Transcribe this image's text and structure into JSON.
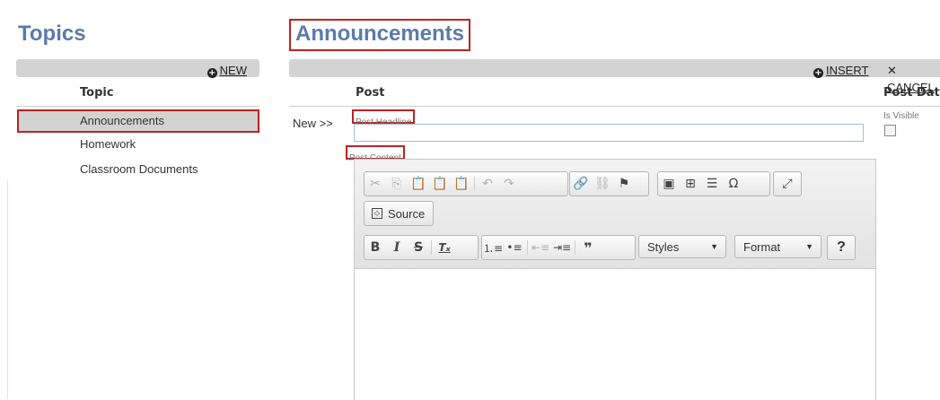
{
  "left": {
    "title": "Topics",
    "new_label": "NEW",
    "column_header": "Topic",
    "topics": [
      "Announcements",
      "Homework",
      "Classroom Documents"
    ]
  },
  "main": {
    "title": "Announcements",
    "insert_label": "INSERT",
    "cancel_label": "CANCEL",
    "col_post": "Post",
    "col_post_date": "Post Date",
    "new_row_label": "New >>",
    "headline_label": "Post Headline",
    "headline_value": "",
    "content_label": "Post Content",
    "is_visible_label": "Is Visible",
    "is_visible_checked": false
  },
  "editor": {
    "source_label": "Source",
    "styles_label": "Styles",
    "format_label": "Format",
    "help_label": "?",
    "icons": {
      "cut": "cut-icon",
      "copy": "copy-icon",
      "paste": "paste-icon",
      "paste_text": "paste-text-icon",
      "paste_word": "paste-word-icon",
      "undo": "undo-icon",
      "redo": "redo-icon",
      "link": "link-icon",
      "unlink": "unlink-icon",
      "anchor": "anchor-flag-icon",
      "image": "image-icon",
      "table": "table-icon",
      "hr": "horizontal-rule-icon",
      "special": "special-char-icon",
      "maximize": "maximize-icon"
    }
  },
  "colors": {
    "heading": "#5b7bab",
    "highlight_border": "#bb2222",
    "bar": "#d3d3d3"
  }
}
